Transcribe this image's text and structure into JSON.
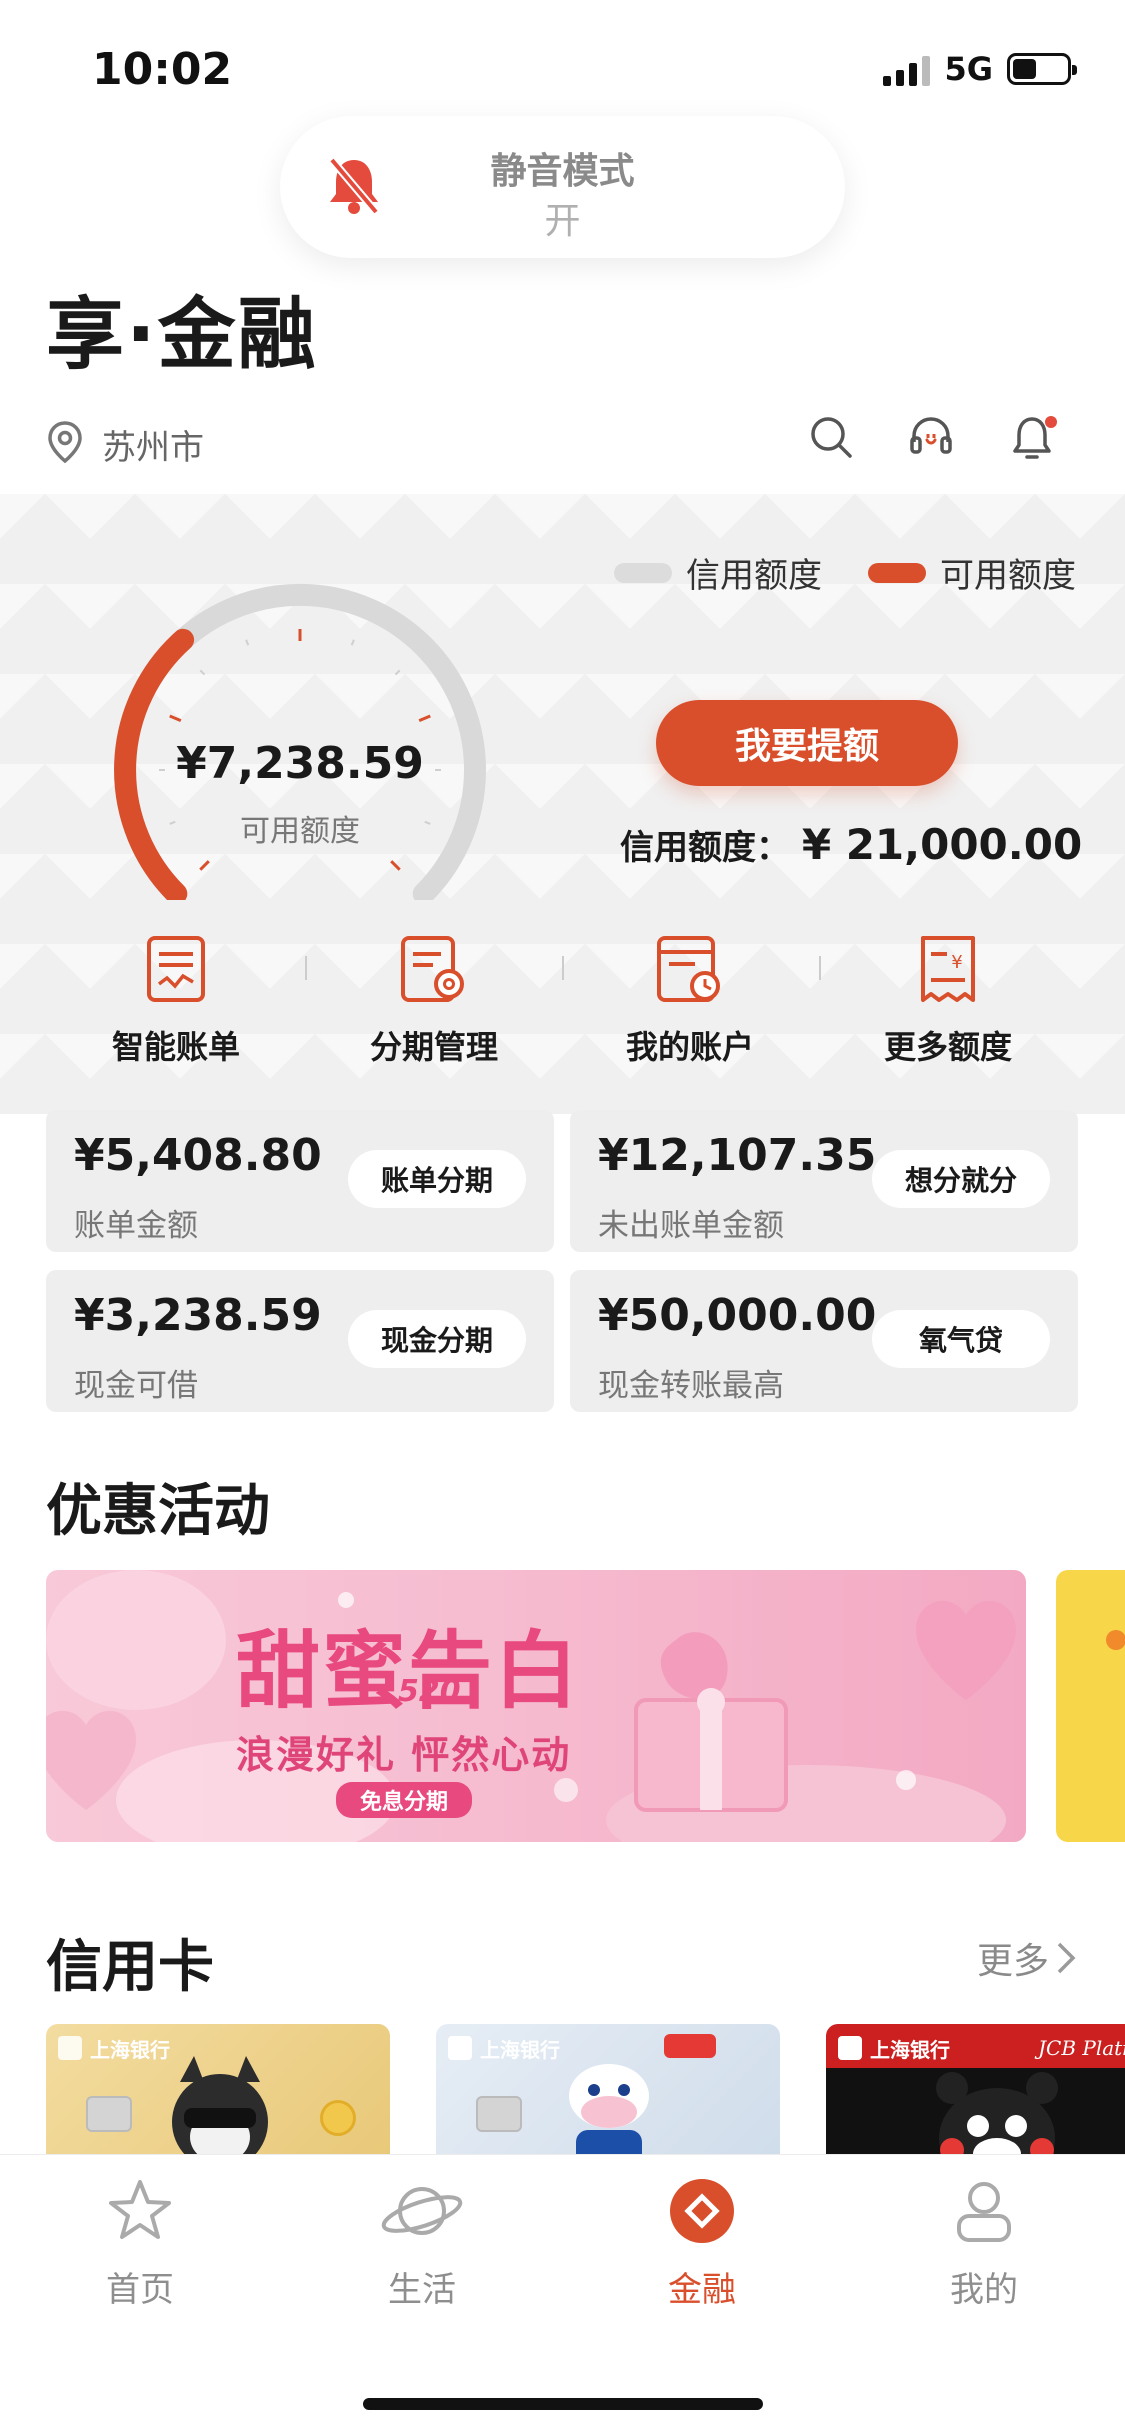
{
  "status_bar": {
    "time": "10:02",
    "network": "5G",
    "battery_level": 0.45
  },
  "silent_mode": {
    "title": "静音模式",
    "state": "开",
    "icon": "bell-slash-icon"
  },
  "header": {
    "title": "享·金融",
    "location": "苏州市",
    "icons": [
      "search-icon",
      "headset-icon",
      "notification-bell-icon"
    ]
  },
  "credit_panel": {
    "legend": [
      {
        "label": "信用额度",
        "color": "#dcdcdc"
      },
      {
        "label": "可用额度",
        "color": "#d94f2b"
      }
    ],
    "gauge": {
      "available": 7238.59,
      "total": 21000.0,
      "value_text": "¥7,238.59",
      "label": "可用额度"
    },
    "raise_button": "我要提额",
    "credit_line_label": "信用额度：",
    "credit_line_value": "¥ 21,000.00",
    "accent_color": "#d94f2b"
  },
  "quick_actions": [
    {
      "label": "智能账单",
      "icon": "bill-chart-icon"
    },
    {
      "label": "分期管理",
      "icon": "installment-settings-icon"
    },
    {
      "label": "我的账户",
      "icon": "account-clock-icon"
    },
    {
      "label": "更多额度",
      "icon": "receipt-yen-icon"
    }
  ],
  "stats": [
    {
      "amount": "¥5,408.80",
      "label": "账单金额",
      "button": "账单分期"
    },
    {
      "amount": "¥12,107.35",
      "label": "未出账单金额",
      "button": "想分就分"
    },
    {
      "amount": "¥3,238.59",
      "label": "现金可借",
      "button": "现金分期"
    },
    {
      "amount": "¥50,000.00",
      "label": "现金转账最高",
      "button": "氧气贷"
    }
  ],
  "promotions": {
    "title": "优惠活动",
    "banner": {
      "headline": "甜蜜告白",
      "badge": "520",
      "tagline": "浪漫好礼 怦然心动",
      "tag": "免息分期"
    }
  },
  "cards": {
    "title": "信用卡",
    "more": "更多",
    "items": [
      {
        "bank": "上海银行",
        "theme": "gold-dog"
      },
      {
        "bank": "上海银行",
        "theme": "light-blue-cow"
      },
      {
        "bank": "上海银行",
        "theme": "black-bear",
        "tag": "JCB Platin"
      }
    ]
  },
  "tab_bar": {
    "tabs": [
      {
        "label": "首页",
        "icon": "star-icon"
      },
      {
        "label": "生活",
        "icon": "planet-icon"
      },
      {
        "label": "金融",
        "icon": "finance-diamond-icon",
        "active": true
      },
      {
        "label": "我的",
        "icon": "user-icon"
      }
    ]
  }
}
